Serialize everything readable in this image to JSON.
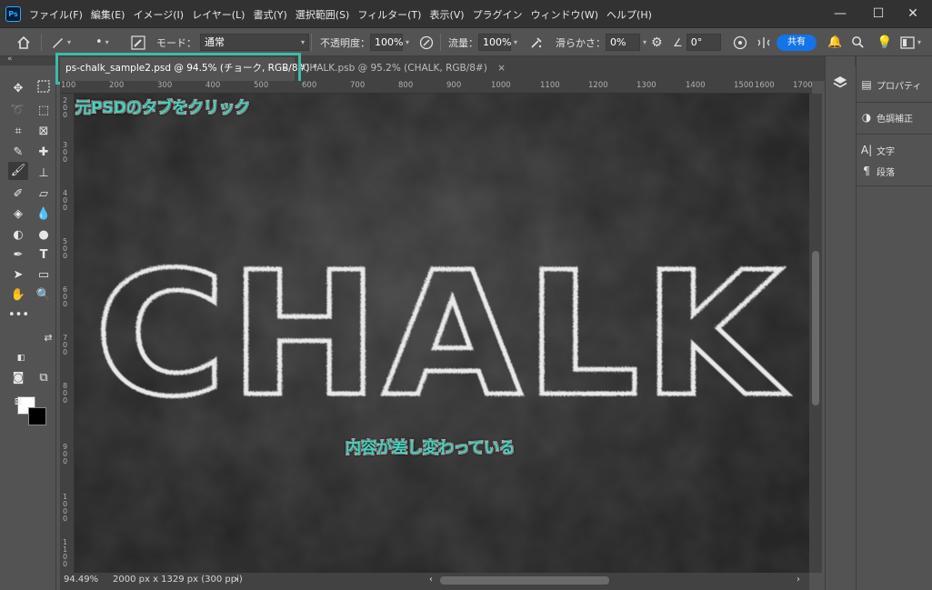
{
  "app": {
    "logo_text": "Ps",
    "menu": [
      "ファイル(F)",
      "編集(E)",
      "イメージ(I)",
      "レイヤー(L)",
      "書式(Y)",
      "選択範囲(S)",
      "フィルター(T)",
      "表示(V)",
      "プラグイン",
      "ウィンドウ(W)",
      "ヘルプ(H)"
    ],
    "window_controls": {
      "minimize": "—",
      "maximize": "☐",
      "close": "✕"
    }
  },
  "options_bar": {
    "mode_label": "モード：",
    "mode_value": "通常",
    "opacity_label": "不透明度：",
    "opacity_value": "100%",
    "flow_label": "流量：",
    "flow_value": "100%",
    "smoothing_label": "滑らかさ：",
    "smoothing_value": "0%",
    "angle_value": "0°",
    "share_label": "共有"
  },
  "tabs": {
    "active_label": "ps-chalk_sample2.psd @ 94.5% (チョーク, RGB/8#) *",
    "inactive_label": "CHALK.psb @ 95.2% (CHALK, RGB/8#)",
    "close_glyph": "×"
  },
  "ruler": {
    "h_labels": [
      "100",
      "200",
      "300",
      "400",
      "500",
      "600",
      "700",
      "800",
      "900",
      "1000",
      "1100",
      "1200",
      "1300",
      "1400",
      "1500",
      "1600",
      "1700"
    ],
    "v_labels": [
      "2\n0\n0",
      "3\n0\n0",
      "4\n0\n0",
      "5\n0\n0",
      "6\n0\n0",
      "7\n0\n0",
      "8\n0\n0",
      "9\n0\n0",
      "1\n0\n0\n0",
      "1\n1\n0\n0"
    ]
  },
  "canvas": {
    "word": "CHALK",
    "bg_color": "#2b2b2b",
    "stroke_color": "#e9e9e9"
  },
  "annotations": {
    "click_tab": "元PSDのタブをクリック",
    "content_changed": "内容が差し変わっている",
    "color": "#4fd0bd"
  },
  "status": {
    "zoom": "94.49%",
    "doc_info": "2000 px x 1329 px (300 ppi)"
  },
  "panels": [
    {
      "icon": "properties-icon",
      "label": "プロパティ"
    },
    {
      "icon": "adjustments-icon",
      "label": "色調補正"
    },
    {
      "icon": "character-icon",
      "label": "文字"
    },
    {
      "icon": "paragraph-icon",
      "label": "段落"
    }
  ],
  "colors": {
    "foreground": "#ffffff",
    "background": "#000000",
    "accent": "#1473e6",
    "highlight_frame": "#3ebba9"
  }
}
